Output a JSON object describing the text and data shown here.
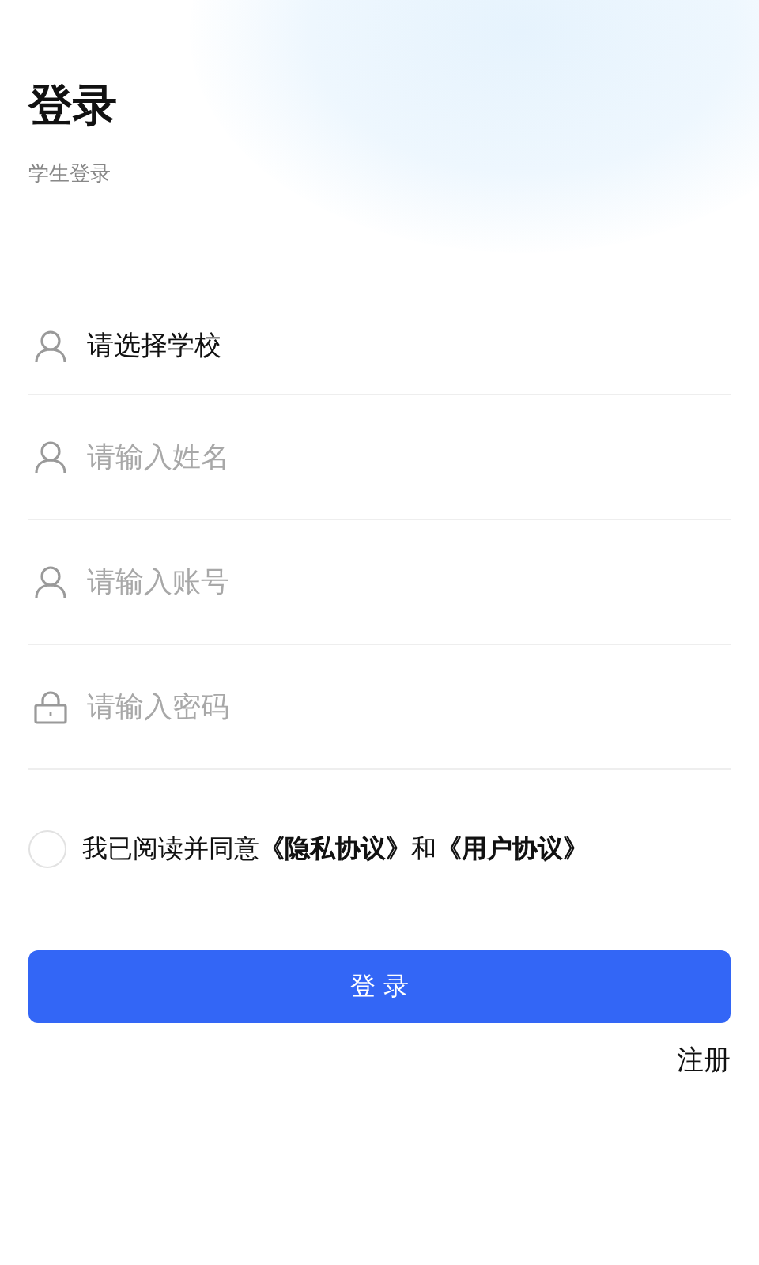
{
  "header": {
    "title": "登录",
    "subtitle": "学生登录"
  },
  "fields": [
    {
      "kind": "select",
      "value": "请选择学校"
    },
    {
      "kind": "input",
      "placeholder": "请输入姓名"
    },
    {
      "kind": "input",
      "placeholder": "请输入账号"
    },
    {
      "kind": "password",
      "placeholder": "请输入密码"
    }
  ],
  "agreement": {
    "checked": false,
    "text": "我已阅读并同意**《隐私协议》**和**《用户协议》**"
  },
  "login_button": "登 录",
  "register_link": "注册"
}
